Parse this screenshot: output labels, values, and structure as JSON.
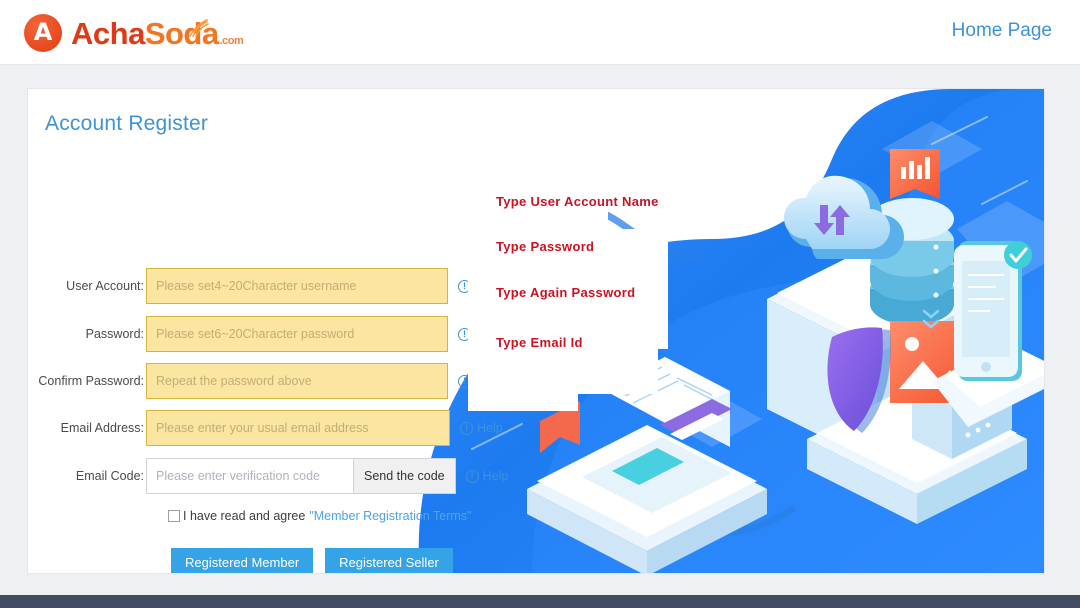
{
  "header": {
    "brand": {
      "mark_glyph": "A",
      "name_part1": "Acha",
      "name_part2": "Soda",
      "tld": ".com"
    },
    "home_page_label": "Home Page"
  },
  "card": {
    "title": "Account Register"
  },
  "form": {
    "help_label": "Help",
    "help_icon_glyph": "!",
    "fields": [
      {
        "label": "User Account:",
        "placeholder": "Please set4~20Character username",
        "value": "",
        "annotation": "Type User Account Name"
      },
      {
        "label": "Password:",
        "placeholder": "Please set6~20Character password",
        "value": "",
        "annotation": "Type Password"
      },
      {
        "label": "Confirm Password:",
        "placeholder": "Repeat the password above",
        "value": "",
        "annotation": "Type Again Password"
      },
      {
        "label": "Email Address:",
        "placeholder": "Please enter your usual email address",
        "value": "",
        "annotation": "Type Email Id"
      },
      {
        "label": "Email Code:",
        "placeholder": "Please enter verification code",
        "value": "",
        "annotation": ""
      }
    ],
    "send_code_label": "Send the code",
    "terms": {
      "text": "I have read and agree",
      "link": "\"Member Registration Terms\"",
      "checked": false
    },
    "buttons": {
      "member": "Registered Member",
      "seller": "Registered Seller"
    }
  },
  "colors": {
    "brand_red": "#df3a18",
    "brand_orange": "#f37521",
    "link_blue": "#3e92d8",
    "button_blue": "#35a3e8",
    "input_yellow": "#fae6a0",
    "input_border": "#d6b33c",
    "annotation_red": "#cc1122",
    "page_background": "#eff0f4",
    "illustration_blue": "#1f7ef0"
  },
  "illustration": {
    "name": "isometric-cloud-security-illustration",
    "elements": [
      "cloud",
      "database-stack",
      "laptop",
      "shield",
      "smartphone",
      "image-card",
      "server-rack"
    ]
  }
}
